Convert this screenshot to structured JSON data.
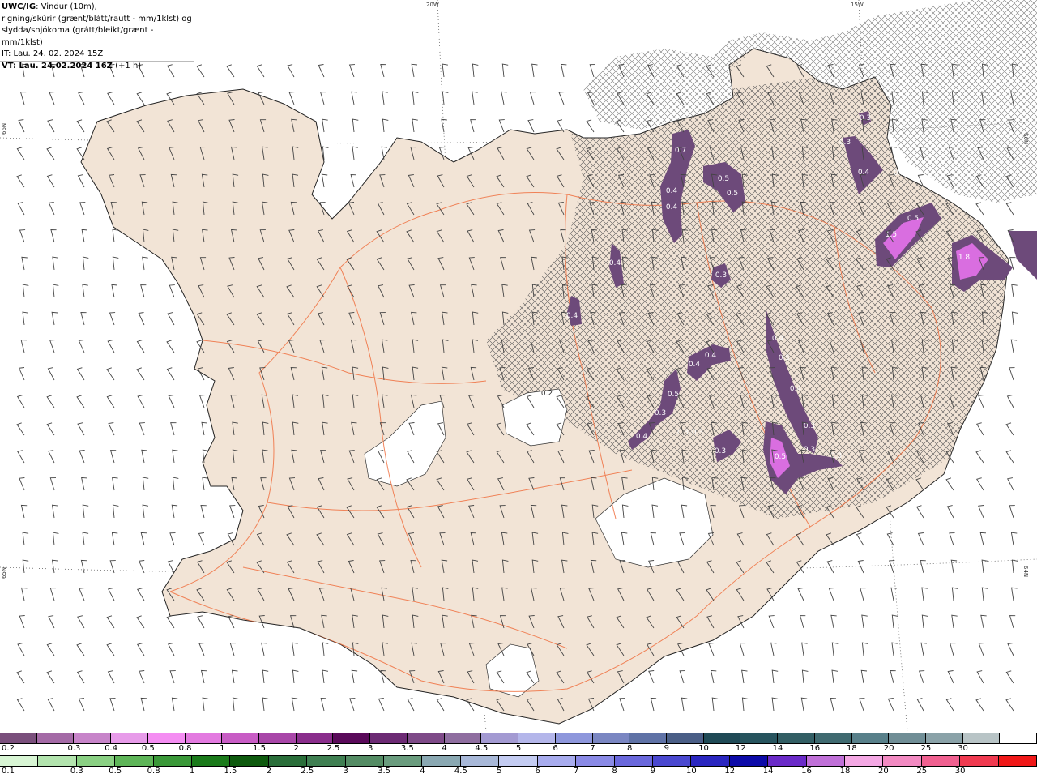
{
  "header": {
    "model": "UWC/IG",
    "line1_rest": ": Vindur (10m),",
    "line2": "rigning/skúrir (grænt/blátt/rautt - mm/1klst) og",
    "line3": "slydda/snjókoma (grátt/bleikt/grænt - mm/1klst)",
    "init_time": "IT: Lau. 24. 02. 2024 15Z",
    "valid_time": "VT: Lau. 24.02.2024 16Z",
    "lead": " (+1 h)"
  },
  "graticule": {
    "lon_labels": [
      "20W",
      "15W"
    ],
    "lat_labels_left": [
      "66N",
      "65N"
    ],
    "lat_labels_right": [
      "66N",
      "64N"
    ]
  },
  "precip_labels": [
    "0.7",
    "0.5",
    "0.5",
    "0.4",
    "0.4",
    "0.4",
    "0.4",
    "0.3",
    "0.3",
    "0.4",
    "0.3",
    "1.5",
    "0.5",
    "1.8",
    "0.3",
    "0.4",
    "0.4",
    "0.5",
    "0.4",
    "0.5",
    "0.4",
    "0.3",
    "0.3",
    "0.3",
    "0.3",
    "0.4",
    "0.3",
    "0.3",
    "0.5",
    "0.3",
    "0.2"
  ],
  "legend_snow": {
    "ticks": [
      "0.2",
      "0.3",
      "0.4",
      "0.5",
      "0.8",
      "1",
      "1.5",
      "2",
      "2.5",
      "3",
      "3.5",
      "4",
      "4.5",
      "5",
      "6",
      "7",
      "8",
      "9",
      "10",
      "12",
      "14",
      "16",
      "18",
      "20",
      "25",
      "30"
    ],
    "colors": [
      "#7a4f7c",
      "#a46aa6",
      "#c784c9",
      "#e79be9",
      "#f48df2",
      "#e37ae0",
      "#c85cc5",
      "#a846a8",
      "#8a2e8c",
      "#5a0a5a",
      "#6c2a74",
      "#7e4a88",
      "#8f6ea0",
      "#a39ad2",
      "#b4b6ea",
      "#8e97dc",
      "#7a86c2",
      "#5f72a6",
      "#4a5e86",
      "#1f4a56",
      "#27545e",
      "#325e64",
      "#3f6a70",
      "#58808a",
      "#708e96",
      "#8aa2a8",
      "#b8c4c6",
      "#ffffff"
    ]
  },
  "legend_rain": {
    "ticks": [
      "0.1",
      "0.3",
      "0.5",
      "0.8",
      "1",
      "1.5",
      "2",
      "2.5",
      "3",
      "3.5",
      "4",
      "4.5",
      "5",
      "6",
      "7",
      "8",
      "9",
      "10",
      "12",
      "14",
      "16",
      "18",
      "20",
      "25",
      "30"
    ],
    "colors": [
      "#d8f5d4",
      "#b3e4ae",
      "#8ad083",
      "#5eb558",
      "#3a9838",
      "#1a7a1a",
      "#0e5a0e",
      "#2a6e3a",
      "#3f7f52",
      "#548c64",
      "#6a9c7e",
      "#8aa8b2",
      "#a8b8d8",
      "#c4ccf2",
      "#a8acee",
      "#8a8ae6",
      "#6a68dc",
      "#4a48d0",
      "#2a26c0",
      "#0c0aa8",
      "#6a2ac8",
      "#c070d8",
      "#f4a8e4",
      "#f28ac2",
      "#f06090",
      "#f03a50",
      "#f01818"
    ]
  }
}
